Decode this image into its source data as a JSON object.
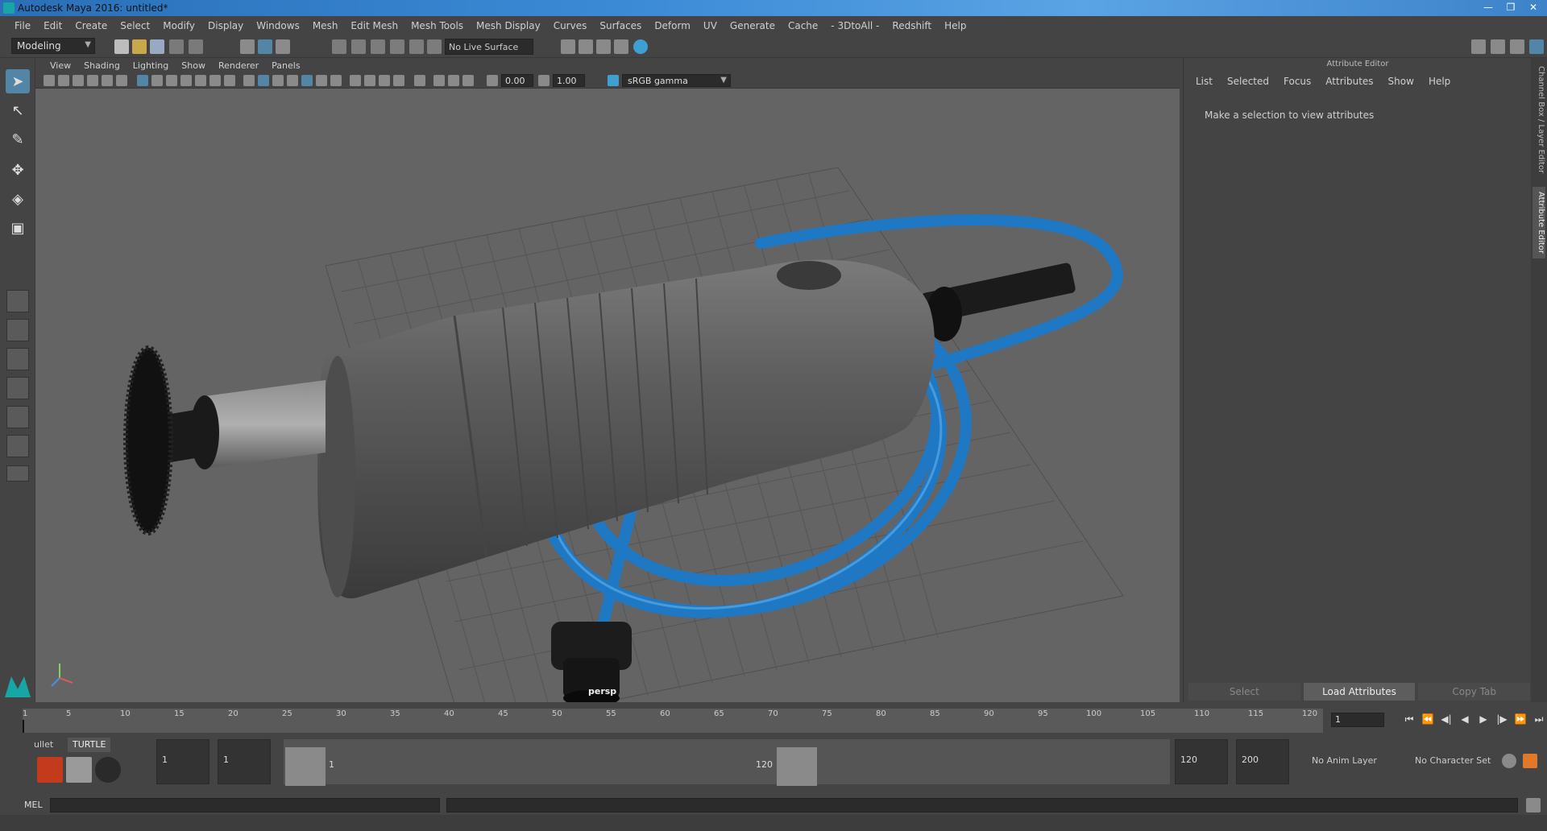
{
  "window": {
    "title": "Autodesk Maya 2016: untitled*",
    "minimize": "—",
    "restore": "❐",
    "close": "✕"
  },
  "menubar": [
    "File",
    "Edit",
    "Create",
    "Select",
    "Modify",
    "Display",
    "Windows",
    "Mesh",
    "Edit Mesh",
    "Mesh Tools",
    "Mesh Display",
    "Curves",
    "Surfaces",
    "Deform",
    "UV",
    "Generate",
    "Cache",
    "- 3DtoAll -",
    "Redshift",
    "Help"
  ],
  "statusline": {
    "mode": "Modeling",
    "live_surface": "No Live Surface"
  },
  "viewport": {
    "menu": [
      "View",
      "Shading",
      "Lighting",
      "Show",
      "Renderer",
      "Panels"
    ],
    "exposure": "0.00",
    "gamma": "1.00",
    "color_space": "sRGB gamma",
    "camera_label": "persp"
  },
  "attribute_editor": {
    "title": "Attribute Editor",
    "menu": [
      "List",
      "Selected",
      "Focus",
      "Attributes",
      "Show",
      "Help"
    ],
    "message": "Make a selection to view attributes",
    "buttons": {
      "select": "Select",
      "load": "Load Attributes",
      "copy": "Copy Tab"
    }
  },
  "side_tabs": {
    "channel_box": "Channel Box / Layer Editor",
    "attribute_editor": "Attribute Editor"
  },
  "timeslider": {
    "ticks": [
      "1",
      "5",
      "10",
      "15",
      "20",
      "25",
      "30",
      "35",
      "40",
      "45",
      "50",
      "55",
      "60",
      "65",
      "70",
      "75",
      "80",
      "85",
      "90",
      "95",
      "100",
      "105",
      "110",
      "115",
      "120"
    ],
    "current_frame": "1"
  },
  "shelf": {
    "tabs": [
      "ullet",
      "TURTLE"
    ]
  },
  "rangeslider": {
    "start": "1",
    "anim_start": "1",
    "range_start_label": "1",
    "range_end_label": "120",
    "anim_end": "120",
    "end": "200",
    "anim_layer": "No Anim Layer",
    "character_set": "No Character Set"
  },
  "cmdline": {
    "label": "MEL"
  },
  "colors": {
    "viewport_bg": "#646464",
    "hose": "#1f78c4",
    "body": "#555555",
    "accent": "#5285a6"
  }
}
